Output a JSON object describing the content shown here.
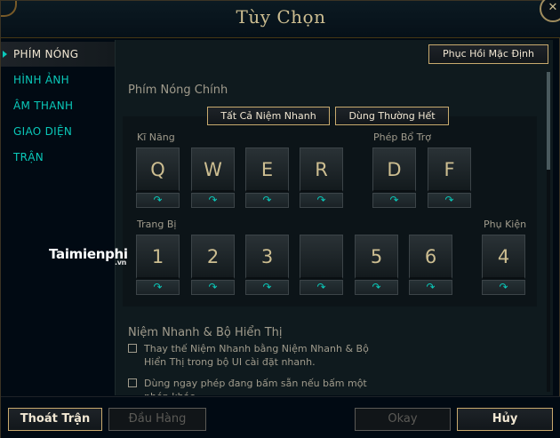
{
  "window": {
    "title": "Tùy Chọn",
    "close_icon": "close-icon"
  },
  "sidebar": {
    "items": [
      {
        "label": "PHÍM NÓNG",
        "active": true
      },
      {
        "label": "HÌNH ẢNH",
        "active": false
      },
      {
        "label": "ÂM THANH",
        "active": false
      },
      {
        "label": "GIAO DIỆN",
        "active": false
      },
      {
        "label": "TRẬN",
        "active": false
      }
    ]
  },
  "content": {
    "restore_button": "Phục Hồi Mặc Định",
    "section_title": "Phím Nóng Chính",
    "quick_cast_all": "Tất Cả Niệm Nhanh",
    "normal_cast_all": "Dùng Thường Hết",
    "labels": {
      "abilities": "Kĩ Năng",
      "summoner": "Phép Bổ Trợ",
      "items": "Trang Bị",
      "trinket": "Phụ Kiện"
    },
    "ability_keys": [
      "Q",
      "W",
      "E",
      "R"
    ],
    "summoner_keys": [
      "D",
      "F"
    ],
    "item_keys": [
      "1",
      "2",
      "3",
      "",
      "5",
      "6"
    ],
    "trinket_key": "4",
    "quickcast_icon": "quickcast-arrow-icon",
    "section2_title": "Niệm Nhanh & Bộ Hiển Thị",
    "options": [
      {
        "text": "Thay thế Niệm Nhanh bằng Niệm Nhanh & Bộ Hiển Thị trong bộ UI cài đặt nhanh.",
        "checked": false
      },
      {
        "text": "Dùng ngay phép đang bấm sẵn nếu bấm một phép khác",
        "checked": false
      }
    ]
  },
  "footer": {
    "leave_game": "Thoát Trận",
    "surrender": "Đầu Hàng",
    "ok": "Okay",
    "cancel": "Hủy"
  },
  "watermark": {
    "text": "Taimienphi",
    "suffix": ".vn"
  },
  "colors": {
    "gold": "#c8aa6e",
    "teal": "#0ac8b9",
    "panel": "#0f1a1e",
    "background": "#010a13"
  }
}
